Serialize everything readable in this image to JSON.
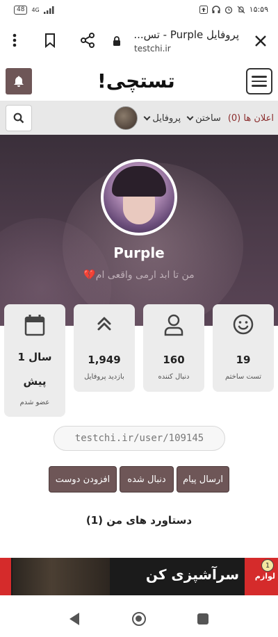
{
  "status_bar": {
    "battery": "48",
    "network": "4G",
    "time": "۱۵:۵۹"
  },
  "browser": {
    "title": "پروفایل Purple - تس...",
    "url": "testchi.ir"
  },
  "site": {
    "logo": "تستچی!"
  },
  "nav": {
    "profile": "پروفایل",
    "build": "ساختن",
    "notifications": "اعلان ها (0)"
  },
  "profile": {
    "username": "Purple",
    "bio": "من تا ابد ارمی واقعی ام💔",
    "link": "testchi.ir/user/109145"
  },
  "stats": [
    {
      "icon": "smile-icon",
      "value": "19",
      "label": "تست ساختم"
    },
    {
      "icon": "user-icon",
      "value": "160",
      "label": "دنبال کننده"
    },
    {
      "icon": "double-chevron-up-icon",
      "value": "1,949",
      "label": "بازدید پروفایل"
    },
    {
      "icon": "calendar-icon",
      "value_line1": "1 سال",
      "value_line2": "پیش",
      "label": "عضو شدم"
    }
  ],
  "actions": {
    "send_message": "ارسال پیام",
    "followed": "دنبال شده",
    "add_friend": "افزودن دوست"
  },
  "achievements_title": "دستاورد های من (1)",
  "ad": {
    "headline": "سرآشپزی کن",
    "brand": "لوازم"
  },
  "colors": {
    "accent": "#6e5657",
    "alert": "#8a2b2b"
  }
}
